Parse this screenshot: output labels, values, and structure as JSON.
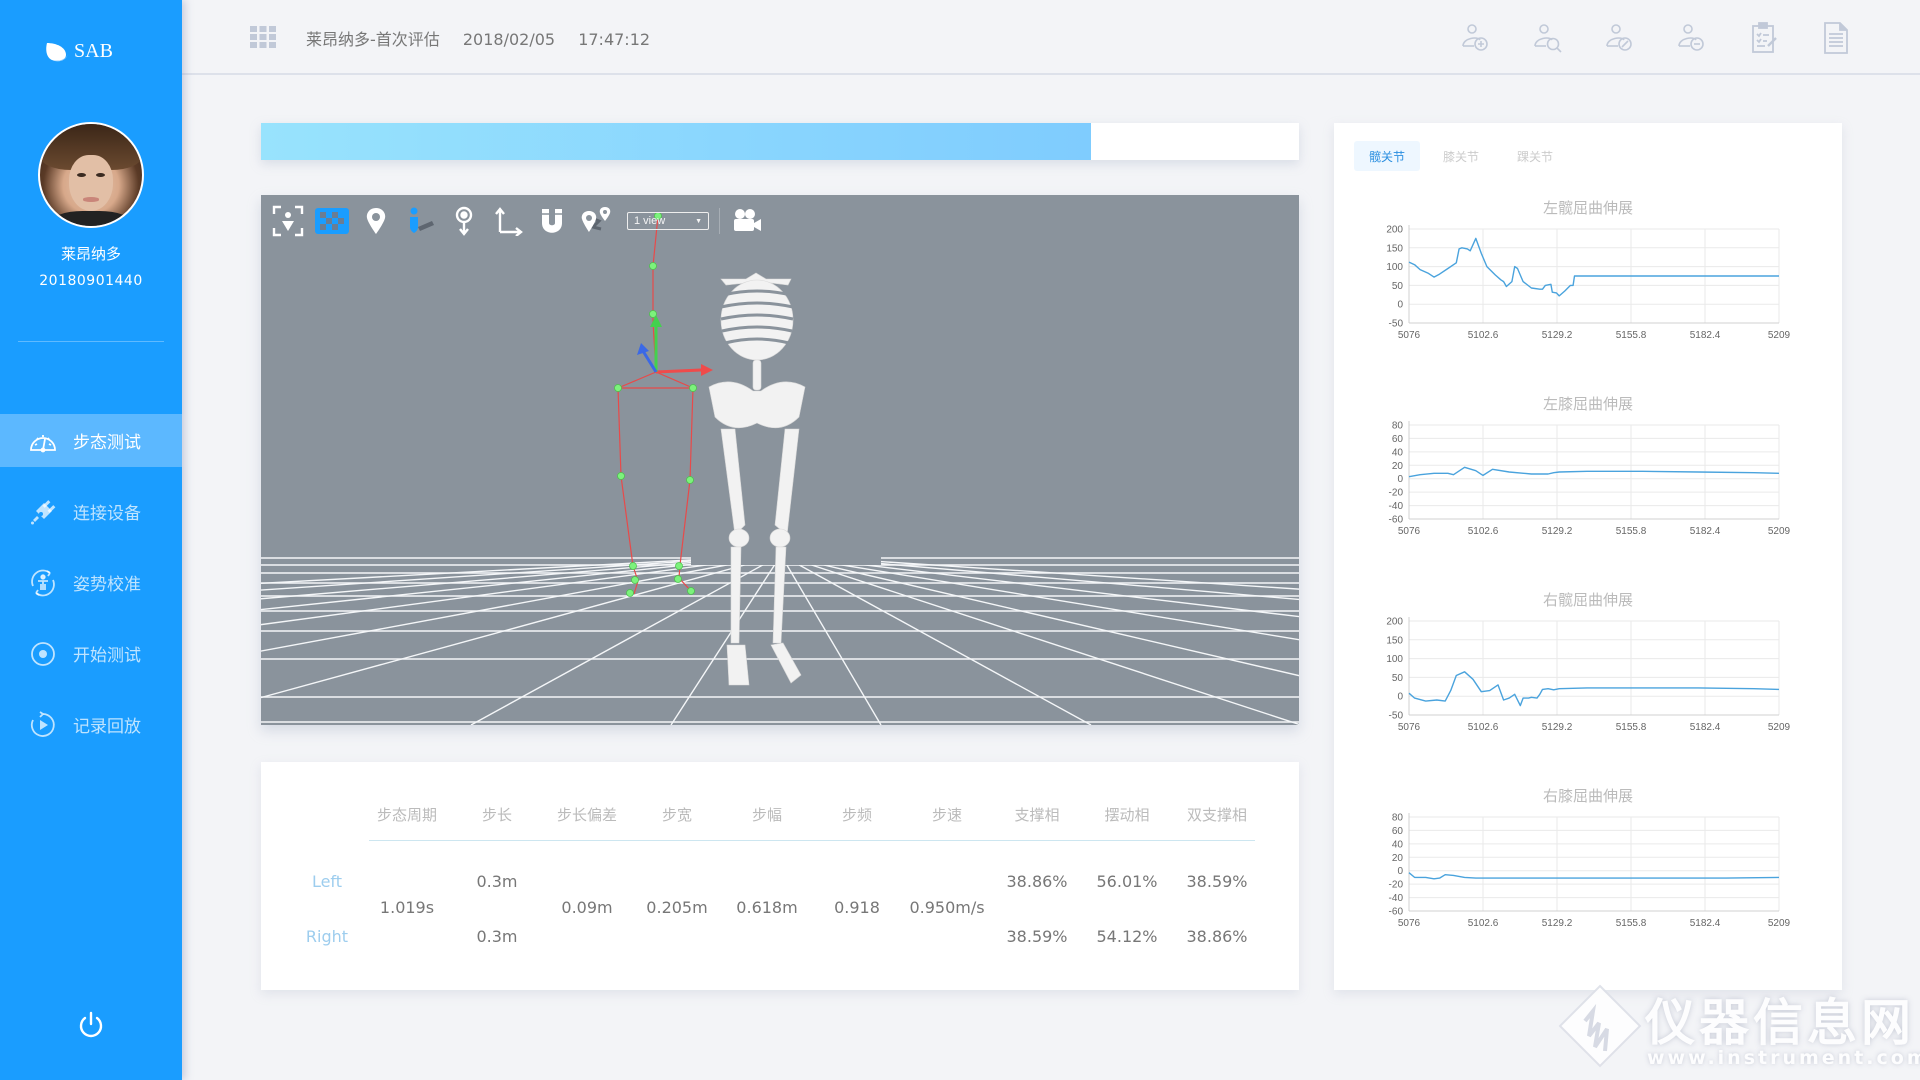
{
  "app": {
    "logo_text": "SAB",
    "brand_color": "#1a9dff",
    "accent_color": "#2b8fe0"
  },
  "sidebar": {
    "user_name": "莱昂纳多",
    "user_id": "20180901440",
    "items": [
      {
        "label": "步态测试",
        "icon": "gauge-icon",
        "active": true
      },
      {
        "label": "连接设备",
        "icon": "plug-icon",
        "active": false
      },
      {
        "label": "姿势校准",
        "icon": "person-calibrate-icon",
        "active": false
      },
      {
        "label": "开始测试",
        "icon": "record-circle-icon",
        "active": false
      },
      {
        "label": "记录回放",
        "icon": "replay-icon",
        "active": false
      }
    ],
    "power_icon": "power-icon"
  },
  "header": {
    "title": "莱昂纳多-首次评估",
    "date": "2018/02/05",
    "time": "17:47:12",
    "icons": [
      "add-user-icon",
      "search-user-icon",
      "edit-user-icon",
      "remove-user-icon",
      "clipboard-edit-icon",
      "document-icon"
    ]
  },
  "progress": {
    "percent": 80
  },
  "viewport": {
    "toolbar": [
      "focus-icon",
      "checkerboard-icon",
      "map-pin-icon",
      "person-shadow-icon",
      "pin-down-icon",
      "axes-icon",
      "magnet-icon",
      "pin-path-icon"
    ],
    "view_select": "1 view",
    "camera_icon": "video-camera-icon"
  },
  "gait_table": {
    "columns": [
      "步态周期",
      "步长",
      "步长偏差",
      "步宽",
      "步幅",
      "步频",
      "步速",
      "支撑相",
      "摆动相",
      "双支撑相"
    ],
    "row_labels": [
      "Left",
      "Right"
    ],
    "shared": {
      "cycle": "1.019s",
      "step_length_dev": "0.09m",
      "step_width": "0.205m",
      "stride": "0.618m",
      "cadence": "0.918",
      "speed": "0.950m/s"
    },
    "left": {
      "step_length": "0.3m",
      "stance": "38.86%",
      "swing": "56.01%",
      "double_support": "38.59%"
    },
    "right": {
      "step_length": "0.3m",
      "stance": "38.59%",
      "swing": "54.12%",
      "double_support": "38.86%"
    }
  },
  "right_panel": {
    "tabs": [
      {
        "label": "髋关节",
        "active": true
      },
      {
        "label": "膝关节",
        "active": false
      },
      {
        "label": "踝关节",
        "active": false
      }
    ]
  },
  "chart_data": [
    {
      "type": "line",
      "title": "左髋屈曲伸展",
      "x_ticks": [
        "5076",
        "5102.6",
        "5129.2",
        "5155.8",
        "5182.4",
        "5209"
      ],
      "y_ticks": [
        "200",
        "150",
        "100",
        "50",
        "0",
        "-50"
      ],
      "xlim": [
        5076,
        5209
      ],
      "ylim": [
        -50,
        200
      ],
      "grid": true,
      "line_color": "#4aa3dd",
      "x": [
        5076,
        5078,
        5080,
        5083,
        5085,
        5087,
        5090,
        5093,
        5094,
        5095,
        5097,
        5098,
        5100,
        5102,
        5104,
        5107,
        5109,
        5110,
        5111,
        5113,
        5114,
        5115,
        5117,
        5120,
        5123,
        5124,
        5125,
        5127,
        5127.5,
        5129,
        5130,
        5132,
        5134,
        5135,
        5135.5,
        5140,
        5209
      ],
      "values": [
        112,
        105,
        92,
        82,
        72,
        80,
        95,
        110,
        147,
        150,
        147,
        142,
        175,
        135,
        100,
        78,
        65,
        60,
        47,
        60,
        100,
        95,
        60,
        43,
        40,
        40,
        50,
        53,
        32,
        30,
        22,
        35,
        50,
        50,
        75,
        75,
        75
      ]
    },
    {
      "type": "line",
      "title": "左膝屈曲伸展",
      "x_ticks": [
        "5076",
        "5102.6",
        "5129.2",
        "5155.8",
        "5182.4",
        "5209"
      ],
      "y_ticks": [
        "80",
        "60",
        "40",
        "20",
        "0",
        "-20",
        "-40",
        "-60"
      ],
      "xlim": [
        5076,
        5209
      ],
      "ylim": [
        -60,
        80
      ],
      "grid": true,
      "line_color": "#4aa3dd",
      "x": [
        5076,
        5080,
        5085,
        5090,
        5092,
        5096,
        5100,
        5102.6,
        5106,
        5112,
        5120,
        5126,
        5128,
        5130,
        5140,
        5160,
        5180,
        5200,
        5209
      ],
      "values": [
        3,
        6,
        8,
        8,
        6,
        17,
        12,
        5,
        14,
        10,
        7,
        7,
        9,
        10,
        11,
        11,
        10,
        9,
        8
      ]
    },
    {
      "type": "line",
      "title": "右髋屈曲伸展",
      "x_ticks": [
        "5076",
        "5102.6",
        "5129.2",
        "5155.8",
        "5182.4",
        "5209"
      ],
      "y_ticks": [
        "200",
        "150",
        "100",
        "50",
        "0",
        "-50"
      ],
      "xlim": [
        5076,
        5209
      ],
      "ylim": [
        -50,
        200
      ],
      "grid": true,
      "line_color": "#4aa3dd",
      "x": [
        5076,
        5078,
        5082,
        5086,
        5089,
        5091,
        5093,
        5096,
        5099,
        5102,
        5105,
        5108,
        5110,
        5112,
        5114,
        5116,
        5117,
        5119,
        5120,
        5122,
        5123,
        5124,
        5126,
        5128,
        5130,
        5140,
        5160,
        5180,
        5200,
        5209
      ],
      "values": [
        8,
        -5,
        -13,
        -10,
        -13,
        15,
        55,
        65,
        45,
        12,
        15,
        30,
        -10,
        -5,
        5,
        -25,
        -5,
        -5,
        -3,
        -5,
        5,
        18,
        20,
        17,
        20,
        22,
        22,
        22,
        20,
        18
      ]
    },
    {
      "type": "line",
      "title": "右膝屈曲伸展",
      "x_ticks": [
        "5076",
        "5102.6",
        "5129.2",
        "5155.8",
        "5182.4",
        "5209"
      ],
      "y_ticks": [
        "80",
        "60",
        "40",
        "20",
        "0",
        "-20",
        "-40",
        "-60"
      ],
      "xlim": [
        5076,
        5209
      ],
      "ylim": [
        -60,
        80
      ],
      "grid": true,
      "line_color": "#4aa3dd",
      "x": [
        5076,
        5078,
        5082,
        5085,
        5087,
        5089,
        5092,
        5096,
        5100,
        5110,
        5130,
        5160,
        5190,
        5209
      ],
      "values": [
        -3,
        -10,
        -10,
        -12,
        -11,
        -6,
        -7,
        -10,
        -11,
        -11,
        -11,
        -11,
        -11,
        -10
      ]
    }
  ],
  "watermark": {
    "title": "仪器信息网",
    "url": "www.instrument.com.cn"
  }
}
